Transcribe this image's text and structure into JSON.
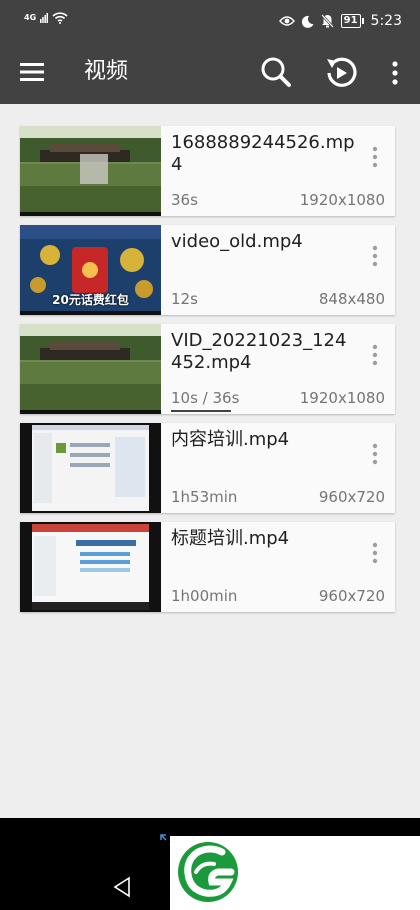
{
  "status_bar": {
    "network": "4G",
    "battery": "91",
    "time": "5:23"
  },
  "toolbar": {
    "title": "视频"
  },
  "videos": [
    {
      "name": "1688889244526.mp4",
      "duration": "36s",
      "resolution": "1920x1080"
    },
    {
      "name": "video_old.mp4",
      "duration": "12s",
      "resolution": "848x480",
      "thumb_text": "20元话费红包"
    },
    {
      "name": "VID_20221023_124452.mp4",
      "duration": "10s / 36s",
      "resolution": "1920x1080",
      "progress": 0.28
    },
    {
      "name": "内容培训.mp4",
      "duration": "1h53min",
      "resolution": "960x720"
    },
    {
      "name": "标题培训.mp4",
      "duration": "1h00min",
      "resolution": "960x720"
    }
  ],
  "colors": {
    "toolbar": "#424242",
    "background": "#eeeeee",
    "card": "#fafafa",
    "logo_green": "#1a9a3a"
  }
}
